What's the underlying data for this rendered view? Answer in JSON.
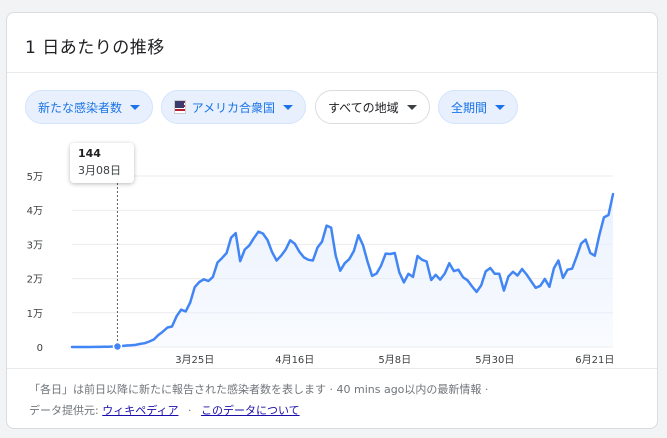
{
  "card": {
    "title": "1 日あたりの推移"
  },
  "chips": {
    "metric": "新たな感染者数",
    "region": "アメリカ合衆国",
    "scope": "すべての地域",
    "period": "全期間"
  },
  "tooltip": {
    "value": "144",
    "date": "3月08日"
  },
  "footer": {
    "note": "「各日」は前日以降に新たに報告された感染者数を表します · 40 mins ago以内の最新情報 ·",
    "provider_label": "データ提供元:",
    "provider_link": "ウィキペディア",
    "dot": "·",
    "about_link": "このデータについて"
  },
  "colors": {
    "line": "#4285f4",
    "fill": "#e8f0fe",
    "chip_bg": "#e8f0fe",
    "chip_text": "#1a73e8",
    "link": "#1a0dab"
  },
  "chart_data": {
    "type": "area",
    "x_start": "2020-02-27",
    "x_step_days": 1,
    "y_tick_labels": [
      "0",
      "1万",
      "2万",
      "3万",
      "4万",
      "5万"
    ],
    "y_tick_values": [
      0,
      10000,
      20000,
      30000,
      40000,
      50000
    ],
    "x_tick_labels": [
      "3月25日",
      "4月16日",
      "5月8日",
      "5月30日",
      "6月21日"
    ],
    "x_tick_dates": [
      "2020-03-25",
      "2020-04-16",
      "2020-05-08",
      "2020-05-30",
      "2020-06-21"
    ],
    "ylim": [
      0,
      50000
    ],
    "highlight": {
      "date": "2020-03-08",
      "value": 144
    },
    "values": [
      0,
      0,
      0,
      0,
      10,
      20,
      40,
      60,
      90,
      144,
      200,
      300,
      450,
      500,
      600,
      900,
      1100,
      1600,
      2200,
      3500,
      4500,
      5700,
      6000,
      9000,
      10900,
      10400,
      13000,
      17500,
      19000,
      19800,
      19300,
      20500,
      24700,
      26000,
      27500,
      32000,
      33300,
      25100,
      28500,
      29700,
      31800,
      33700,
      33200,
      31300,
      27800,
      25300,
      26700,
      28500,
      31200,
      30200,
      27900,
      26200,
      25500,
      25300,
      29100,
      30800,
      35500,
      34900,
      26700,
      22300,
      24500,
      25700,
      28100,
      32700,
      29800,
      25000,
      20800,
      21500,
      23800,
      27300,
      27200,
      27500,
      21800,
      18900,
      21400,
      20500,
      26600,
      25500,
      25000,
      19600,
      21100,
      19700,
      21500,
      24500,
      22200,
      22600,
      20400,
      19500,
      17700,
      16100,
      18000,
      22100,
      23100,
      21400,
      21400,
      16500,
      20600,
      22000,
      20900,
      22800,
      21200,
      19200,
      17300,
      17900,
      19900,
      17600,
      23000,
      25300,
      20200,
      22600,
      22900,
      26400,
      30300,
      31400,
      27500,
      26700,
      32800,
      37900,
      38600,
      44700
    ]
  }
}
